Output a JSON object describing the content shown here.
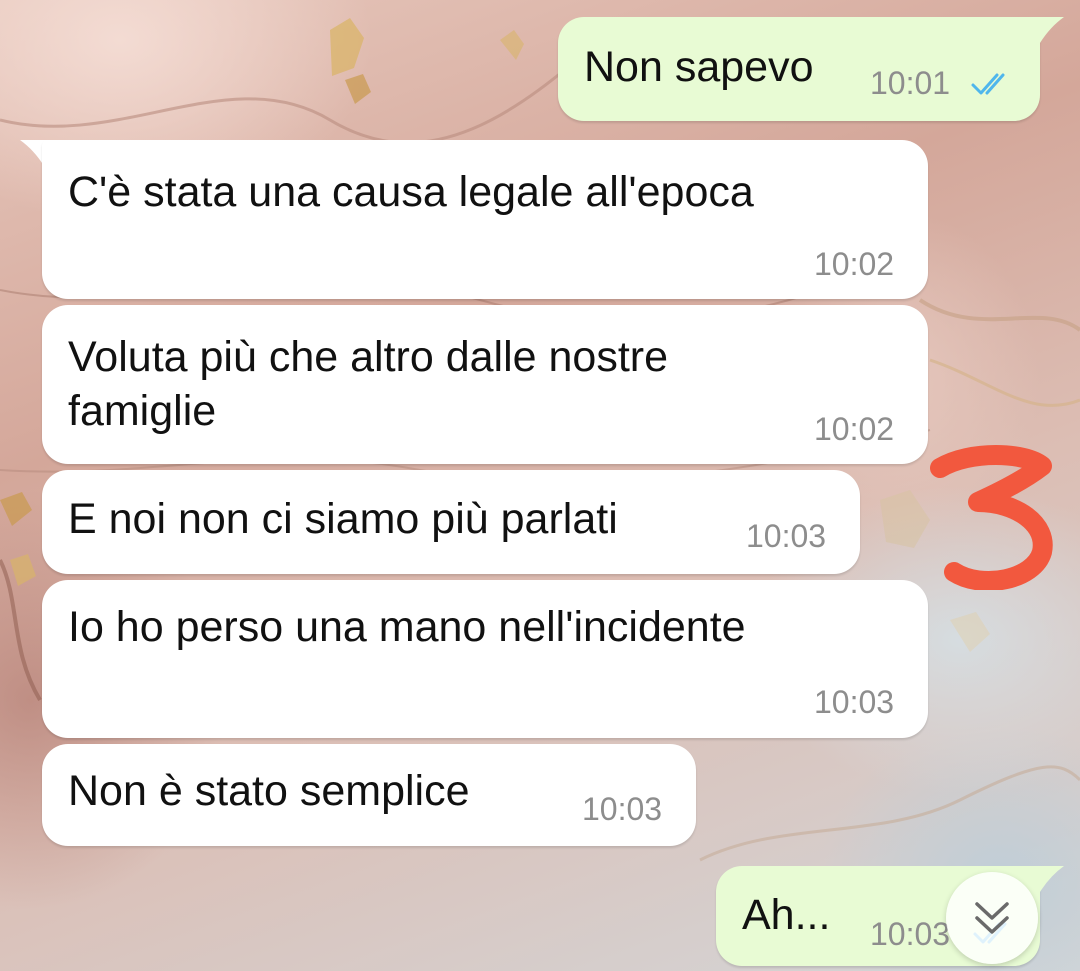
{
  "colors": {
    "incoming_bubble": "#ffffff",
    "outgoing_bubble": "#e8fbd4",
    "read_ticks": "#4fb6ec",
    "timestamp": "#8d8d8d",
    "annotation": "#f2583e"
  },
  "messages": [
    {
      "direction": "outgoing",
      "text": "Non sapevo",
      "time": "10:01",
      "status": "read"
    },
    {
      "direction": "incoming",
      "text": "C'è stata una causa legale all'epoca",
      "time": "10:02"
    },
    {
      "direction": "incoming",
      "text": "Voluta più che altro dalle nostre\nfamiglie",
      "time": "10:02"
    },
    {
      "direction": "incoming",
      "text": "E noi non ci siamo più parlati",
      "time": "10:03"
    },
    {
      "direction": "incoming",
      "text": "Io ho perso una mano nell'incidente",
      "time": "10:03"
    },
    {
      "direction": "incoming",
      "text": "Non è stato semplice",
      "time": "10:03"
    },
    {
      "direction": "outgoing",
      "text": "Ah...",
      "time": "10:03",
      "status": "read"
    }
  ],
  "annotation": {
    "text": "3",
    "icon": "handwritten-number-three"
  },
  "scroll_button": {
    "icon": "double-chevron-down-icon"
  }
}
